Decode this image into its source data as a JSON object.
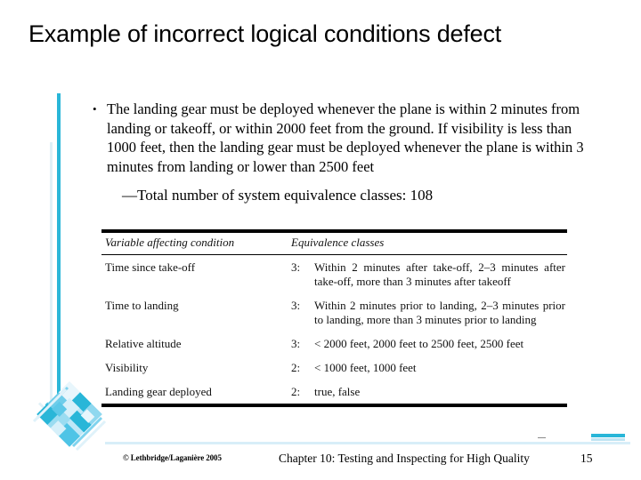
{
  "slide": {
    "title": "Example of incorrect logical conditions defect",
    "bullet": {
      "marker": "•",
      "text": "The landing gear must be deployed whenever the plane is within 2 minutes from landing or takeoff, or within 2000 feet from the ground. If visibility is less than 1000 feet, then the landing gear must be deployed whenever the plane is within 3 minutes from landing or lower than 2500 feet"
    },
    "subbullet": {
      "text": "—Total number of system equivalence classes: 108"
    }
  },
  "table": {
    "headers": {
      "variable": "Variable affecting condition",
      "classes": "Equivalence classes"
    },
    "rows": [
      {
        "variable": "Time since take-off",
        "count": "3:",
        "classes": "Within 2 minutes after take-off, 2–3 minutes after take-off, more than 3 minutes after takeoff"
      },
      {
        "variable": "Time to landing",
        "count": "3:",
        "classes": "Within 2 minutes prior to landing, 2–3 minutes prior to landing, more than 3 minutes prior to landing"
      },
      {
        "variable": "Relative altitude",
        "count": "3:",
        "classes": "< 2000 feet, 2000 feet to 2500 feet, 2500 feet"
      },
      {
        "variable": "Visibility",
        "count": "2:",
        "classes": "< 1000 feet, 1000 feet"
      },
      {
        "variable": "Landing gear deployed",
        "count": "2:",
        "classes": "true, false"
      }
    ]
  },
  "footer": {
    "copyright": "© Lethbridge/Laganière 2005",
    "center": "Chapter 10: Testing and Inspecting for High Quality",
    "page": "15"
  },
  "colors": {
    "accent_cyan": "#29b6d8",
    "accent_light": "#d8eef8",
    "rule_black": "#000000"
  }
}
